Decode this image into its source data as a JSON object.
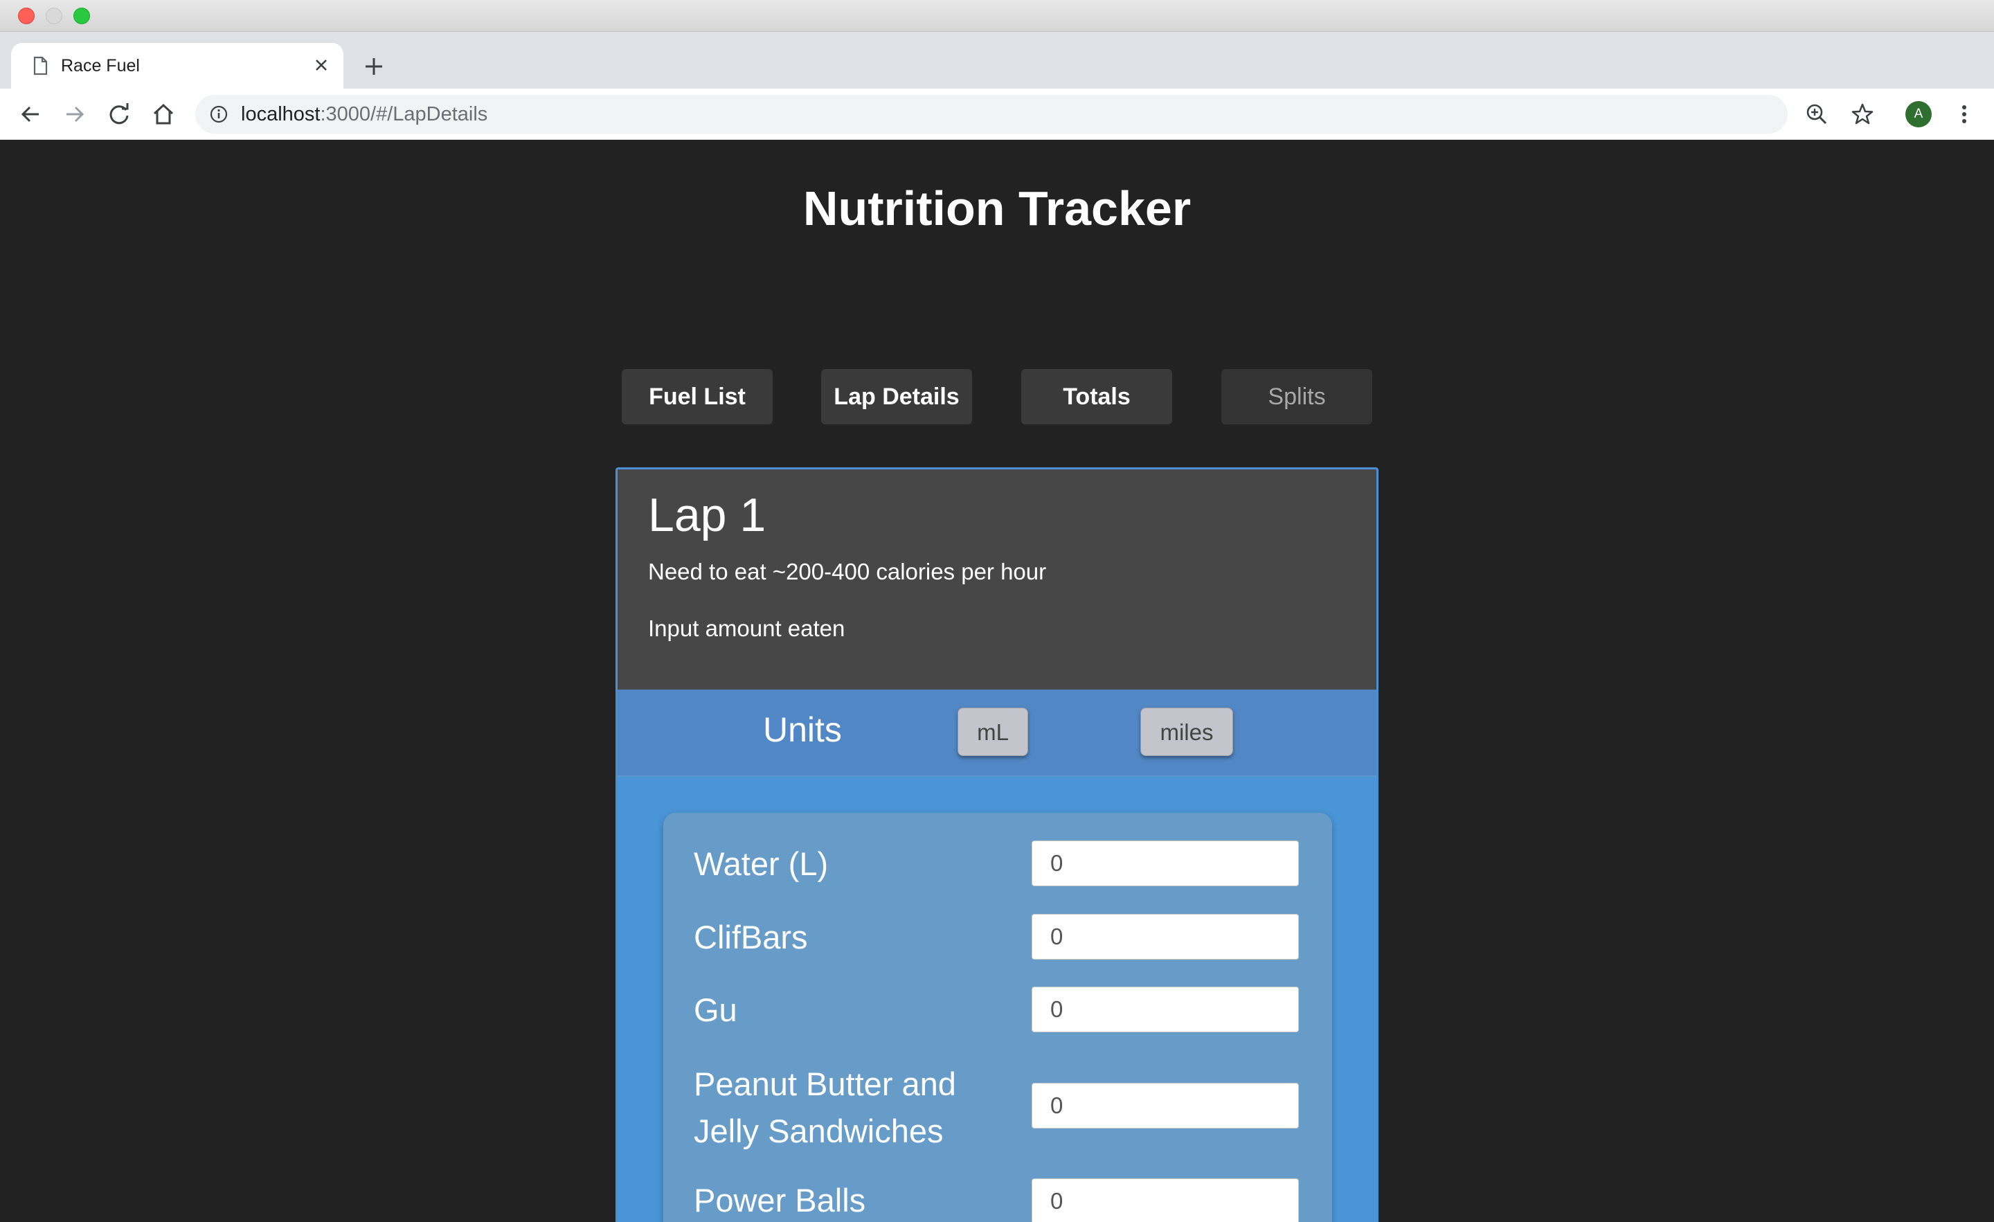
{
  "browser": {
    "tab_title": "Race Fuel",
    "url_host": "localhost",
    "url_rest": ":3000/#/LapDetails",
    "avatar_letter": "A",
    "icons": [
      "page-icon",
      "close-icon",
      "plus-icon",
      "back-arrow-icon",
      "forward-arrow-icon",
      "reload-icon",
      "home-icon",
      "info-icon",
      "zoom-icon",
      "star-icon",
      "menu-dots-icon"
    ]
  },
  "app": {
    "title": "Nutrition Tracker",
    "nav": {
      "fuel_list": "Fuel List",
      "lap_details": "Lap Details",
      "totals": "Totals",
      "splits": "Splits"
    },
    "lap": {
      "title": "Lap 1",
      "need": "Need to eat ~200-400 calories per hour",
      "instruction": "Input amount eaten"
    },
    "units": {
      "label": "Units",
      "ml": "mL",
      "miles": "miles"
    },
    "fuel_items": [
      {
        "label": "Water (L)",
        "value": "0"
      },
      {
        "label": "ClifBars",
        "value": "0"
      },
      {
        "label": "Gu",
        "value": "0"
      },
      {
        "label": "Peanut Butter and Jelly Sandwiches",
        "value": "0"
      },
      {
        "label": "Power Balls",
        "value": "0"
      }
    ],
    "colors": {
      "page_bg": "#222222",
      "card_header": "#474747",
      "units_bar": "#5087c4",
      "panel": "#679cc9",
      "card_border": "#4a90d2"
    }
  }
}
